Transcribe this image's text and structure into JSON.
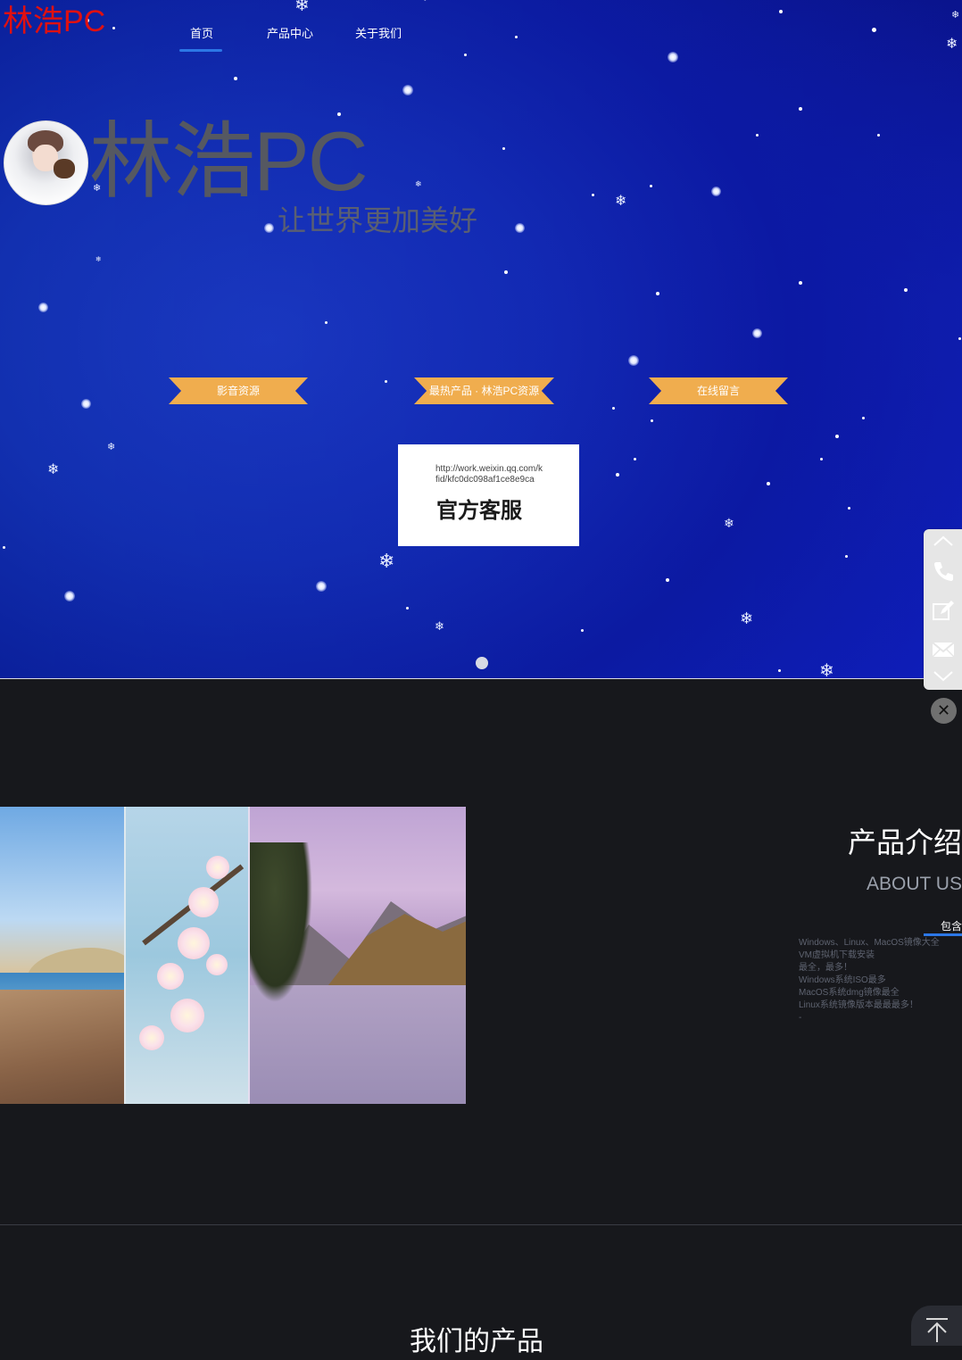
{
  "brand": {
    "name": "林浩PC",
    "color": "#e01010"
  },
  "nav": {
    "items": [
      {
        "label": "首页",
        "active": true
      },
      {
        "label": "产品中心",
        "active": false
      },
      {
        "label": "关于我们",
        "active": false
      }
    ],
    "accent": "#2c77e6"
  },
  "hero": {
    "avatar_icon": "avatar-photo",
    "title": "林浩PC",
    "subtitle": "让世界更加美好",
    "ribbons": [
      {
        "label": "影音资源"
      },
      {
        "label": "最热产品 · 林浩PC资源"
      },
      {
        "label": "在线留言"
      }
    ],
    "ribbon_color": "#f0ad4e",
    "popup": {
      "url": "http://work.weixin.qq.com/kfid/kfc0dc098af1ce8e9ca",
      "title": "官方客服"
    },
    "slide_count": 1
  },
  "side_toolbar": {
    "items": [
      {
        "icon": "chevron-up-icon"
      },
      {
        "icon": "phone-icon"
      },
      {
        "icon": "edit-icon"
      },
      {
        "icon": "mail-icon"
      },
      {
        "icon": "chevron-down-icon"
      }
    ],
    "close_symbol": "✕"
  },
  "about": {
    "title": "产品介绍",
    "subtitle_en": "ABOUT US",
    "tag": "包含",
    "description_lines": [
      "Windows、Linux、MacOS镜像大全",
      "VM虚拟机下载安装",
      "最全，最多！",
      "Windows系统ISO最多",
      "MacOS系统dmg镜像最全",
      "Linux系统镜像版本最最最多！",
      "-"
    ]
  },
  "products": {
    "title": "我们的产品"
  },
  "back_to_top": {
    "icon": "arrow-up-to-top-icon"
  }
}
